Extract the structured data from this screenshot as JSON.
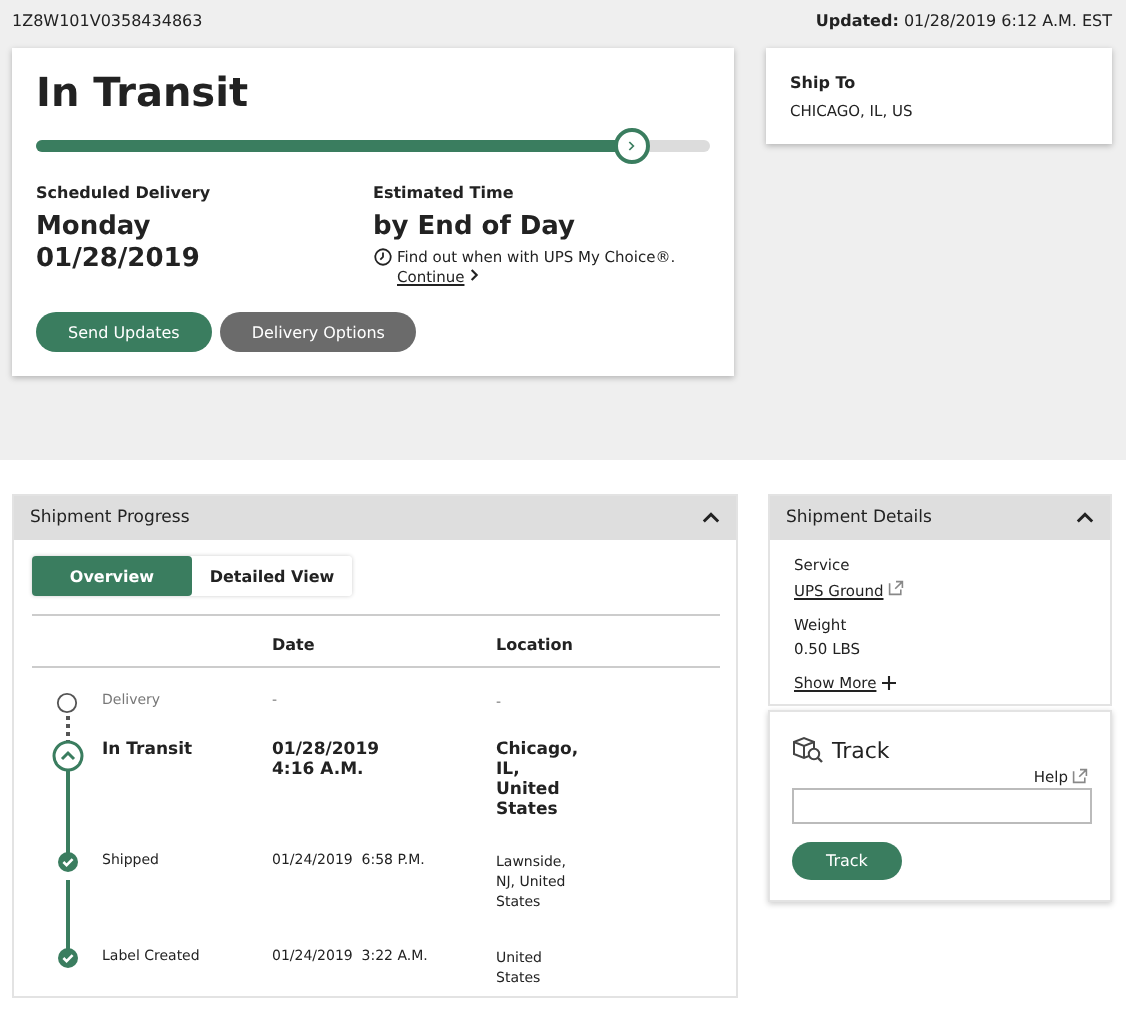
{
  "header": {
    "tracking_number": "1Z8W101V0358434863",
    "updated": "**Updated:** 01/28/2019 6:12 A.M. EST"
  },
  "status_card": {
    "status": "In Transit",
    "progress": {
      "level": 0.88
    },
    "scheduled": {
      "label": "Scheduled Delivery",
      "day": "Monday",
      "date": "01/28/2019"
    },
    "estimated": {
      "label": "Estimated Time",
      "value": "by End of Day",
      "note": "Find out when with UPS My Choice®.",
      "link": "Continue"
    },
    "buttons": [
      {
        "label": "Send Updates",
        "kind": "primary"
      },
      {
        "label": "Delivery Options",
        "kind": "secondary"
      }
    ]
  },
  "ship_to": {
    "label": "Ship To",
    "value": "CHICAGO, IL, US"
  },
  "shipment_progress": {
    "title": "Shipment Progress",
    "expanded": true,
    "tabs": [
      {
        "label": "Overview",
        "selected": true
      },
      {
        "label": "Detailed View",
        "selected": false
      }
    ],
    "columns": [
      "Date",
      "Location"
    ],
    "rows": [
      {
        "kind": "pending",
        "status": "Delivery",
        "date": "-",
        "location": "-"
      },
      {
        "kind": "current",
        "status": "In Transit",
        "date": "01/28/2019 4:16 A.M.",
        "location": "Chicago, IL, United States"
      },
      {
        "kind": "done",
        "status": "Shipped",
        "date": "01/24/2019  6:58 P.M.",
        "location": "Lawnside, NJ, United States"
      },
      {
        "kind": "done",
        "status": "Label Created",
        "date": "01/24/2019  3:22 A.M.",
        "location": "United States"
      }
    ]
  },
  "shipment_details": {
    "title": "Shipment Details",
    "expanded": true,
    "fields": [
      {
        "label": "Service",
        "value": "UPS Ground",
        "kind": "link"
      },
      {
        "label": "Weight",
        "value": "0.50 LBS",
        "kind": "text"
      }
    ],
    "show_more": "Show More"
  },
  "track": {
    "title": "Track",
    "help": "Help",
    "button": "Track"
  }
}
